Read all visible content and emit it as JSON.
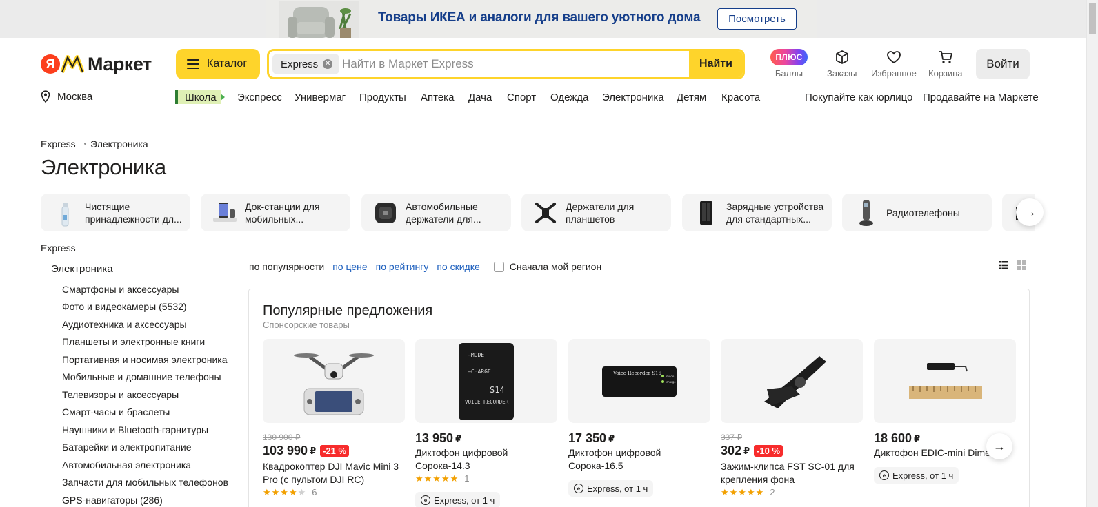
{
  "promo": {
    "text": "Товары ИКЕА и аналоги для вашего уютного дома",
    "button": "Посмотреть"
  },
  "header": {
    "logo_ya": "Я",
    "logo_text": "Маркет",
    "catalog": "Каталог",
    "search": {
      "chip": "Express",
      "placeholder": "Найти в Маркет Express",
      "button": "Найти"
    },
    "actions": {
      "plus_badge": "ПЛЮС",
      "points": "Баллы",
      "orders": "Заказы",
      "favorites": "Избранное",
      "cart": "Корзина"
    },
    "login": "Войти",
    "city": "Москва",
    "nav": [
      "Школа",
      "Экспресс",
      "Универмаг",
      "Продукты",
      "Аптека",
      "Дача",
      "Спорт",
      "Одежда",
      "Электроника",
      "Детям",
      "Красота"
    ],
    "right_links": [
      "Покупайте как юрлицо",
      "Продавайте на Маркете"
    ]
  },
  "breadcrumb": [
    "Express",
    "Электроника"
  ],
  "title": "Электроника",
  "categories": [
    "Чистящие принадлежности дл...",
    "Док-станции для мобильных...",
    "Автомобильные держатели для...",
    "Держатели для планшетов",
    "Зарядные устройства для стандартных...",
    "Радиотелефоны"
  ],
  "sidebar": {
    "root": "Express",
    "current": "Электроника",
    "items": [
      "Смартфоны и аксессуары",
      "Фото и видеокамеры (5532)",
      "Аудиотехника и аксессуары",
      "Планшеты и электронные книги",
      "Портативная и носимая электроника",
      "Мобильные и домашние телефоны",
      "Телевизоры и аксессуары",
      "Смарт-часы и браслеты",
      "Наушники и Bluetooth-гарнитуры",
      "Батарейки и электропитание",
      "Автомобильная электроника",
      "Запчасти для мобильных телефонов",
      "GPS-навигаторы (286)"
    ]
  },
  "sort": {
    "popular": "по популярности",
    "price": "по цене",
    "rating": "по рейтингу",
    "discount": "по скидке",
    "my_region": "Сначала мой регион"
  },
  "popular": {
    "title": "Популярные предложения",
    "subtitle": "Спонсорские товары",
    "products": [
      {
        "old_price": "130 900 ₽",
        "price": "103 990",
        "currency": "₽",
        "discount": "-21 %",
        "name": "Квадрокоптер DJI Mavic Mini 3 Pro (с пультом DJI RC)",
        "rating": 4,
        "reviews": "6"
      },
      {
        "price": "13 950",
        "currency": "₽",
        "name": "Диктофон цифровой Сорока-14.3",
        "rating": 5,
        "reviews": "1",
        "express": "Express, от 1 ч"
      },
      {
        "price": "17 350",
        "currency": "₽",
        "name": "Диктофон цифровой Сорока-16.5",
        "express": "Express, от 1 ч"
      },
      {
        "old_price": "337 ₽",
        "price": "302",
        "currency": "₽",
        "discount": "-10 %",
        "name": "Зажим-клипса FST SC-01 для крепления фона",
        "rating": 5,
        "reviews": "2"
      },
      {
        "price": "18 600",
        "currency": "₽",
        "name": "Диктофон EDIC-mini Dime...",
        "express": "Express, от 1 ч"
      }
    ]
  }
}
